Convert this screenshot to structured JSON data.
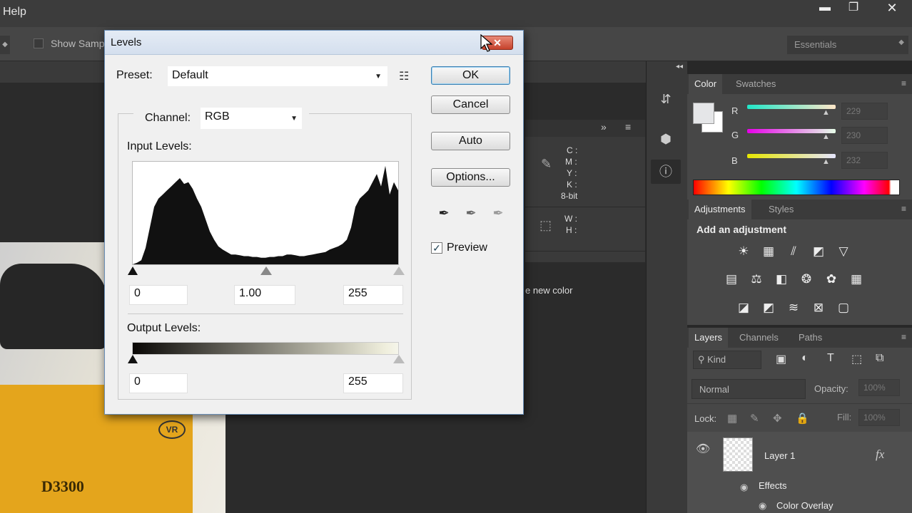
{
  "menubar": {
    "help": "Help",
    "minimize": "▬",
    "restore": "❐",
    "close": "✕"
  },
  "optionsbar": {
    "show_sample": "Show Samp",
    "workspace": "Essentials"
  },
  "info_panel": {
    "cmyk": [
      "C :",
      "M :",
      "Y :",
      "K :"
    ],
    "bitdepth": "8-bit",
    "wh": [
      "W :",
      "H :"
    ],
    "new_color": "e new color"
  },
  "photo": {
    "model": "D3300",
    "vr": "VR"
  },
  "levels": {
    "title": "Levels",
    "preset_label": "Preset:",
    "preset_value": "Default",
    "channel_label": "Channel:",
    "channel_value": "RGB",
    "input_label": "Input Levels:",
    "input_black": "0",
    "input_gamma": "1.00",
    "input_white": "255",
    "output_label": "Output Levels:",
    "output_black": "0",
    "output_white": "255",
    "ok": "OK",
    "cancel": "Cancel",
    "auto": "Auto",
    "options": "Options...",
    "preview": "Preview",
    "preview_checked": true,
    "close": "✕",
    "histogram": [
      0,
      2,
      5,
      20,
      45,
      70,
      80,
      85,
      90,
      95,
      100,
      105,
      98,
      100,
      92,
      80,
      70,
      55,
      40,
      30,
      22,
      18,
      15,
      12,
      12,
      11,
      10,
      10,
      9,
      9,
      8,
      8,
      9,
      9,
      10,
      10,
      12,
      12,
      11,
      10,
      10,
      11,
      12,
      13,
      14,
      15,
      18,
      20,
      22,
      25,
      30,
      45,
      70,
      80,
      85,
      90,
      100,
      110,
      95,
      120,
      85,
      100,
      90
    ]
  },
  "color_panel": {
    "tabs": [
      "Color",
      "Swatches"
    ],
    "r_label": "R",
    "g_label": "G",
    "b_label": "B",
    "r": "229",
    "g": "230",
    "b": "232",
    "fg_color": "#e5e6e8"
  },
  "adjustments_panel": {
    "tabs": [
      "Adjustments",
      "Styles"
    ],
    "heading": "Add an adjustment",
    "icons_row1": [
      "☀",
      "▦",
      "⫽",
      "◩",
      "▽"
    ],
    "icons_row2": [
      "▤",
      "⚖",
      "◧",
      "❂",
      "✿",
      "▦"
    ],
    "icons_row3": [
      "◪",
      "◩",
      "≋",
      "⊠",
      "▢"
    ]
  },
  "layers_panel": {
    "tabs": [
      "Layers",
      "Channels",
      "Paths"
    ],
    "kind": "Kind",
    "blend_mode": "Normal",
    "opacity_label": "Opacity:",
    "opacity_value": "100%",
    "lock_label": "Lock:",
    "fill_label": "Fill:",
    "fill_value": "100%",
    "layer_name": "Layer 1",
    "fx": "fx",
    "effects": "Effects",
    "color_overlay": "Color Overlay"
  }
}
